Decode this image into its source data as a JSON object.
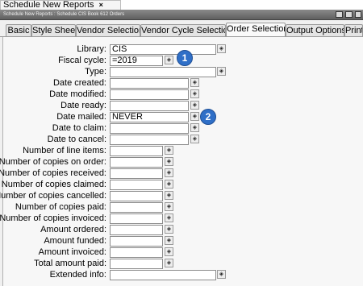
{
  "document_tab": {
    "label": "Schedule New Reports",
    "close": "×"
  },
  "title_strip": {
    "text": "Schedule New Reports : Schedule CIS Book 612 Orders"
  },
  "tabs": [
    {
      "label": "Basic"
    },
    {
      "label": "Style Sheet"
    },
    {
      "label": "Vendor Selection"
    },
    {
      "label": "Vendor Cycle Selection"
    },
    {
      "label": "Order Selection"
    },
    {
      "label": "Output Options"
    },
    {
      "label": "Print"
    }
  ],
  "active_tab": "Order Selection",
  "fields": [
    {
      "label": "Library:",
      "value": "CIS"
    },
    {
      "label": "Fiscal cycle:",
      "value": "=2019"
    },
    {
      "label": "Type:",
      "value": ""
    },
    {
      "label": "Date created:",
      "value": ""
    },
    {
      "label": "Date modified:",
      "value": ""
    },
    {
      "label": "Date ready:",
      "value": ""
    },
    {
      "label": "Date mailed:",
      "value": "NEVER"
    },
    {
      "label": "Date to claim:",
      "value": ""
    },
    {
      "label": "Date to cancel:",
      "value": ""
    },
    {
      "label": "Number of line items:",
      "value": ""
    },
    {
      "label": "Number of copies on order:",
      "value": ""
    },
    {
      "label": "Number of copies received:",
      "value": ""
    },
    {
      "label": "Number of copies claimed:",
      "value": ""
    },
    {
      "label": "Number of copies cancelled:",
      "value": ""
    },
    {
      "label": "Number of copies paid:",
      "value": ""
    },
    {
      "label": "Number of copies invoiced:",
      "value": ""
    },
    {
      "label": "Amount ordered:",
      "value": ""
    },
    {
      "label": "Amount funded:",
      "value": ""
    },
    {
      "label": "Amount invoiced:",
      "value": ""
    },
    {
      "label": "Total amount paid:",
      "value": ""
    },
    {
      "label": "Extended info:",
      "value": ""
    }
  ],
  "picker_glyph": "◈",
  "callouts": [
    {
      "text": "1"
    },
    {
      "text": "2"
    }
  ],
  "colors": {
    "callout": "#2f6fc7",
    "tab_border": "#9a9a9a"
  }
}
